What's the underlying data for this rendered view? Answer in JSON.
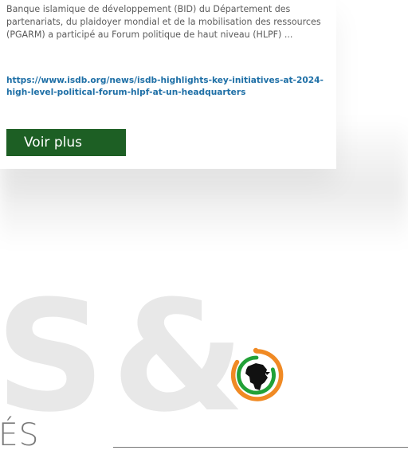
{
  "article": {
    "excerpt": "Banque islamique de développement (BID) du Département des partenariats, du plaidoyer mondial et de la mobilisation des ressources (PGARM) a participé au Forum politique de haut niveau (HLPF) ...",
    "link": "https://www.isdb.org/news/isdb-highlights-key-initiatives-at-2024-high-level-political-forum-hlpf-at-un-headquarters",
    "more_label": "Voir plus"
  },
  "decor": {
    "ghost_left": "S",
    "ghost_right": "&",
    "heading_fragment": "ÉS"
  },
  "logo": {
    "icon": "africa-logo-icon",
    "colors": {
      "orange": "#f08a24",
      "green": "#22a137",
      "dark": "#111111"
    }
  },
  "colors": {
    "text": "#5b5b5b",
    "link": "#1e6fa6",
    "button": "#1d5f24",
    "ghost": "#e8e8e8",
    "divider": "#767676"
  }
}
